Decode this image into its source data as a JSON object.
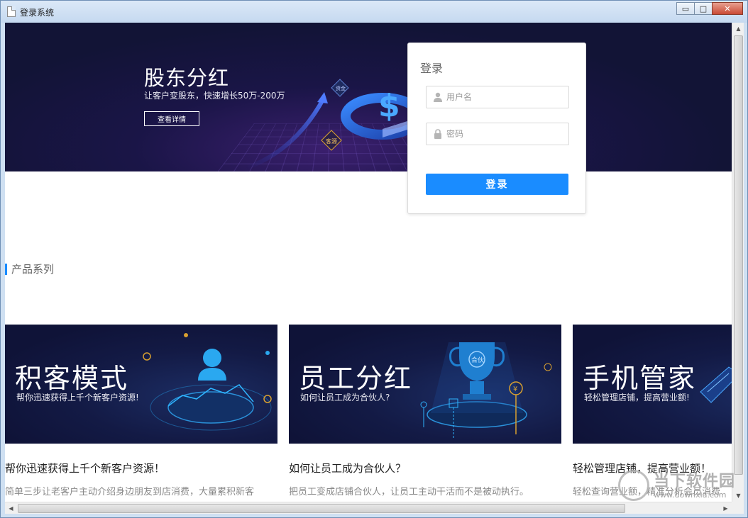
{
  "window": {
    "title": "登录系统",
    "minimize_label": "▭",
    "maximize_label": "□",
    "close_label": "✕"
  },
  "banner": {
    "title": "股东分红",
    "subtitle": "让客户变股东，快速增长50万-200万",
    "button_label": "查看详情",
    "tag_funds": "资金",
    "tag_customers": "客源"
  },
  "login": {
    "title": "登录",
    "username_placeholder": "用户名",
    "password_placeholder": "密码",
    "submit_label": "登录"
  },
  "products": {
    "section_title": "产品系列",
    "cards": [
      {
        "img_title": "积客模式",
        "img_subtitle": "帮你迅速获得上千个新客户资源!",
        "heading": "帮你迅速获得上千个新客户资源！",
        "desc": "简单三步让老客户主动介绍身边朋友到店消费，大量累积新客"
      },
      {
        "img_title": "员工分红",
        "img_subtitle": "如何让员工成为合伙人?",
        "heading": "如何让员工成为合伙人？",
        "desc": "把员工变成店铺合伙人，让员工主动干活而不是被动执行。",
        "trophy_label": "合伙",
        "coin_label": "¥"
      },
      {
        "img_title": "手机管家",
        "img_subtitle": "轻松管理店铺，提高营业额!",
        "heading": "轻松管理店铺，提高营业额！",
        "desc": "轻松查询营业额，精准分析会员消费"
      }
    ]
  },
  "watermark": {
    "text": "当下软件园",
    "url": "www.downxia.com"
  },
  "colors": {
    "accent": "#1a8cff",
    "banner_bg": "#121436",
    "card_bg": "#0f1338"
  }
}
